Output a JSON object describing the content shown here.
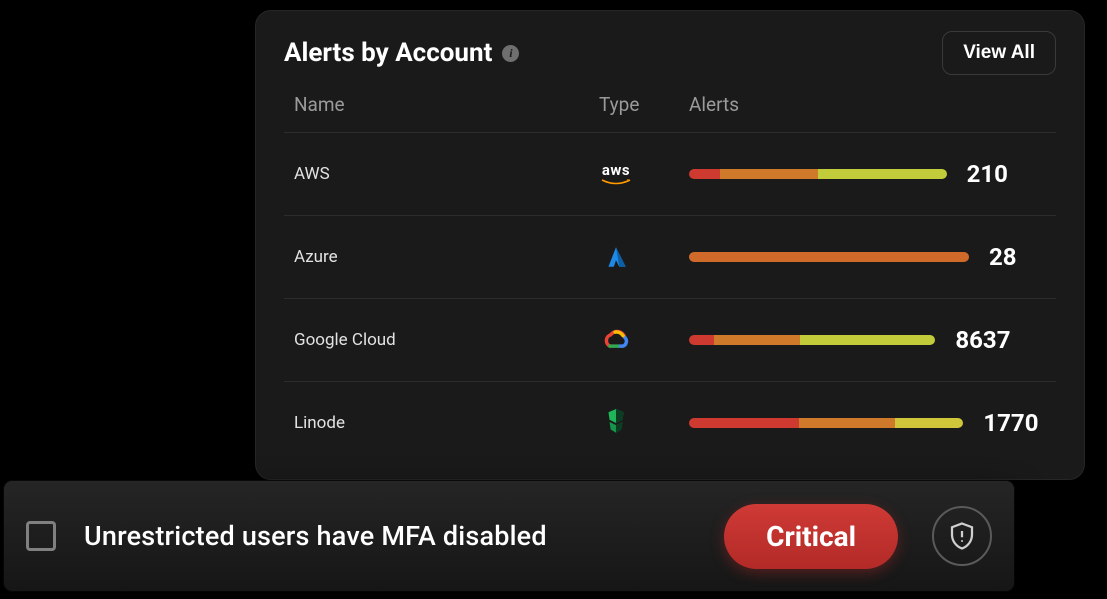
{
  "card": {
    "title": "Alerts by Account",
    "view_all_label": "View All",
    "columns": {
      "name": "Name",
      "type": "Type",
      "alerts": "Alerts"
    },
    "rows": [
      {
        "name": "AWS",
        "type": "aws",
        "count": "210",
        "bar_width_pct": 92,
        "segments": [
          {
            "color": "#cf3a30",
            "pct": 12
          },
          {
            "color": "#cf7a2a",
            "pct": 38
          },
          {
            "color": "#c2cc3a",
            "pct": 50
          }
        ]
      },
      {
        "name": "Azure",
        "type": "azure",
        "count": "28",
        "bar_width_pct": 100,
        "segments": [
          {
            "color": "#cf6a2a",
            "pct": 100
          }
        ]
      },
      {
        "name": "Google Cloud",
        "type": "gcloud",
        "count": "8637",
        "bar_width_pct": 88,
        "segments": [
          {
            "color": "#cf3a30",
            "pct": 10
          },
          {
            "color": "#cf7a2a",
            "pct": 35
          },
          {
            "color": "#c2cc3a",
            "pct": 55
          }
        ]
      },
      {
        "name": "Linode",
        "type": "linode",
        "count": "1770",
        "bar_width_pct": 98,
        "segments": [
          {
            "color": "#cf3a30",
            "pct": 40
          },
          {
            "color": "#cf7a2a",
            "pct": 35
          },
          {
            "color": "#d0c63a",
            "pct": 25
          }
        ]
      }
    ]
  },
  "alert": {
    "text": "Unrestricted users have MFA disabled",
    "severity": "Critical"
  }
}
